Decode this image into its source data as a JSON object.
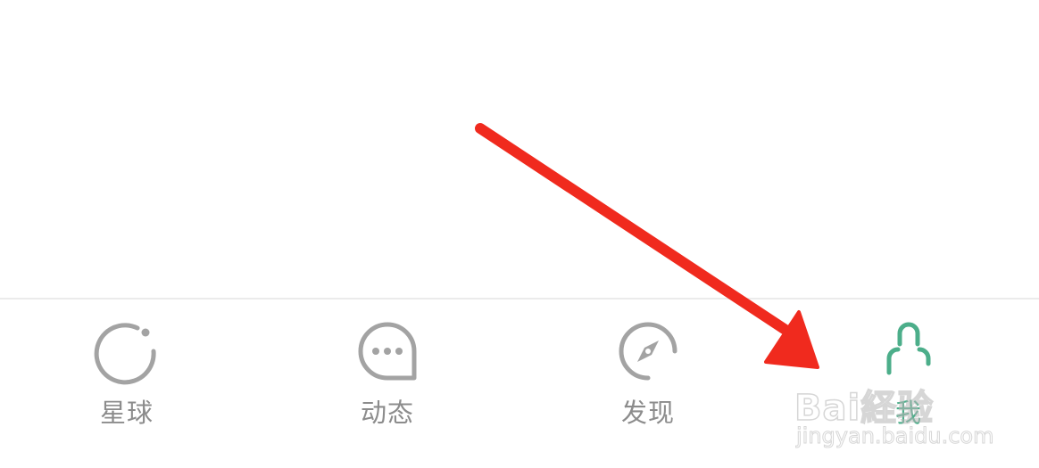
{
  "colors": {
    "inactive": "#a3a3a3",
    "active": "#4cae8a",
    "label_inactive": "#8c8c8c",
    "annotation_arrow": "#f02a1e"
  },
  "tabbar": {
    "tabs": [
      {
        "label": "星球",
        "icon": "planet-icon",
        "active": false
      },
      {
        "label": "动态",
        "icon": "chat-bubble-icon",
        "active": false
      },
      {
        "label": "发现",
        "icon": "compass-icon",
        "active": false
      },
      {
        "label": "我",
        "icon": "profile-icon",
        "active": true
      }
    ]
  },
  "watermark": {
    "brand": "Bai経验",
    "url": "jingyan.baidu.com"
  }
}
